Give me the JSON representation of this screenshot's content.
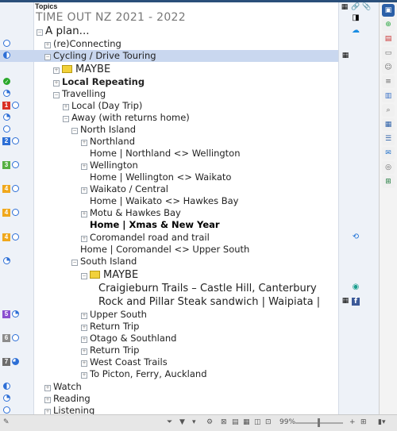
{
  "header": {
    "title": "Topics"
  },
  "title_row": "TIME OUT NZ 2021 - 2022",
  "plan": "A plan...",
  "rows": [
    {
      "label": "(re)Connecting"
    },
    {
      "label": "Cycling / Drive Touring"
    },
    {
      "label": "MAYBE"
    },
    {
      "label": "Local Repeating"
    },
    {
      "label": "Travelling"
    },
    {
      "label": "Local (Day Trip)"
    },
    {
      "label": "Away (with returns home)"
    },
    {
      "label": "North Island"
    },
    {
      "label": "Northland"
    },
    {
      "label": "Home | Northland <> Wellington"
    },
    {
      "label": "Wellington"
    },
    {
      "label": "Home | Wellington <> Waikato"
    },
    {
      "label": "Waikato / Central"
    },
    {
      "label": "Home | Waikato <> Hawkes Bay"
    },
    {
      "label": "Motu & Hawkes Bay"
    },
    {
      "label": "Home | Xmas & New Year"
    },
    {
      "label": "Coromandel road and trail"
    },
    {
      "label": "Home | Coromandel <> Upper South"
    },
    {
      "label": "South Island"
    },
    {
      "label": "MAYBE"
    },
    {
      "label": "Craigieburn Trails – Castle Hill, Canterbury"
    },
    {
      "label": "Rock and Pillar Steak sandwich | Waipiata |"
    },
    {
      "label": "Upper South"
    },
    {
      "label": "Return Trip"
    },
    {
      "label": "Otago & Southland"
    },
    {
      "label": "Return Trip"
    },
    {
      "label": "West Coast Trails"
    },
    {
      "label": "To Picton, Ferry, Auckland"
    },
    {
      "label": "Watch"
    },
    {
      "label": "Reading"
    },
    {
      "label": "Listening"
    }
  ],
  "priorities": {
    "p1": "1",
    "p2": "2",
    "p3": "3",
    "p4a": "4",
    "p4b": "4",
    "p4c": "4",
    "p5": "5",
    "p6": "6",
    "p7": "7"
  },
  "status_bar": {
    "zoom": "99%"
  },
  "colors": {
    "selection": "#c9d7ef",
    "progress": "#2d6fd6",
    "flag": "#f2d13a"
  }
}
